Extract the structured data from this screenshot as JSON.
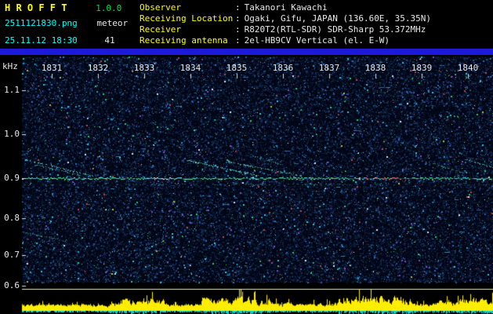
{
  "header": {
    "title": "H R O F F T",
    "version": "1.0.0",
    "filename": "2511121830.png",
    "mode": "meteor",
    "datetime": "25.11.12 18:30",
    "count": "41"
  },
  "info": {
    "separator": ":",
    "rows": [
      {
        "label": "Observer",
        "value": "Takanori Kawachi"
      },
      {
        "label": "Receiving Location",
        "value": "Ogaki, Gifu, JAPAN (136.60E, 35.35N)"
      },
      {
        "label": "Receiver",
        "value": "R820T2(RTL-SDR) SDR-Sharp 53.372MHz"
      },
      {
        "label": "Receiving antenna",
        "value": "2el-HB9CV Vertical (el. E-W)"
      }
    ]
  },
  "chart_data": {
    "type": "heatmap",
    "title": "HROFFT 10-minute meteor radio echo spectrogram",
    "x_axis": {
      "tick_labels": [
        "1831",
        "1832",
        "1833",
        "1834",
        "1835",
        "1836",
        "1837",
        "1838",
        "1839",
        "1840"
      ]
    },
    "y_axis": {
      "label": "kHz",
      "tick_labels": [
        "1.1",
        "1.0",
        "0.9",
        "0.8",
        "0.7",
        "0.6"
      ],
      "range": [
        0.55,
        1.15
      ]
    },
    "features": {
      "main_echo_trace_khz": 0.9,
      "noise_floor": "dense dark-blue speckle noise with scattered cyan, green, red and purple specks",
      "streaks": "faint diagonal doppler streaks converging on the 0.9 kHz echo line",
      "strip_chart": "yellow signal-level bars with cyan marker bars along the bottom edge"
    },
    "colors": {
      "background": "#000000",
      "noise_base": "#010616",
      "trace_green": "#44dd77",
      "trace_cyan": "#44ccee",
      "trace_red": "#ff6666",
      "level_bars": "#ffee00",
      "marker_bars": "#00d8d8",
      "separator_bar": "#1a1ad8",
      "label_yellow": "#ffff00",
      "label_cyan": "#00ffff",
      "label_green": "#00dd44",
      "text_white": "#e8e8e8"
    }
  }
}
